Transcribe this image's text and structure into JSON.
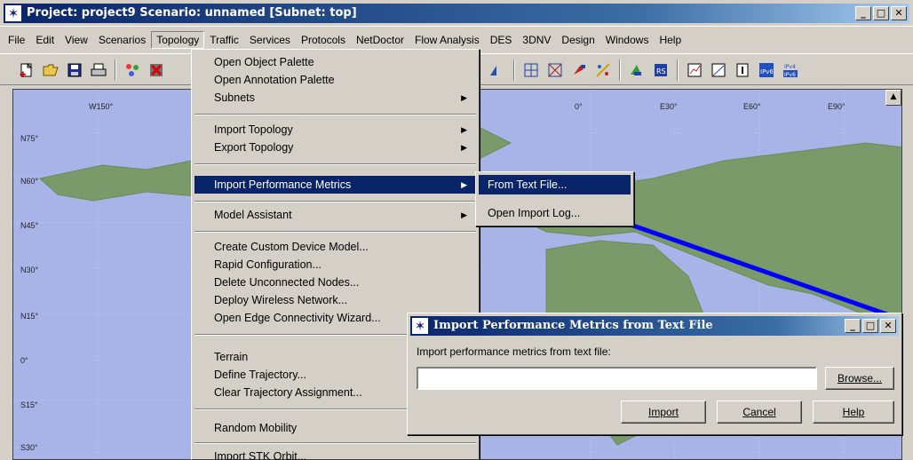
{
  "window": {
    "title": "Project: project9 Scenario: unnamed  [Subnet: top]",
    "minimize": "_",
    "maximize": "□",
    "close": "✕"
  },
  "menubar": [
    "File",
    "Edit",
    "View",
    "Scenarios",
    "Topology",
    "Traffic",
    "Services",
    "Protocols",
    "NetDoctor",
    "Flow Analysis",
    "DES",
    "3DNV",
    "Design",
    "Windows",
    "Help"
  ],
  "map": {
    "longitudes": [
      "W150°",
      "0°",
      "E30°",
      "E60°",
      "E90°"
    ],
    "latitudes": [
      "N75°",
      "N60°",
      "N45°",
      "N30°",
      "N15°",
      "0°",
      "S15°",
      "S30°"
    ],
    "ocean_color": "#a8b4e8",
    "land_color": "#7a9a6a"
  },
  "topology_menu": {
    "items": [
      {
        "label": "Open Object Palette"
      },
      {
        "label": "Open Annotation Palette"
      },
      {
        "label": "Subnets",
        "arrow": "▶"
      },
      {
        "label": "Import Topology",
        "arrow": "▶"
      },
      {
        "label": "Export Topology",
        "arrow": "▶"
      },
      {
        "label": "Import Performance Metrics",
        "arrow": "▶"
      },
      {
        "label": "Model Assistant",
        "arrow": "▶"
      },
      {
        "label": "Create Custom Device Model..."
      },
      {
        "label": "Rapid Configuration..."
      },
      {
        "label": "Delete Unconnected Nodes..."
      },
      {
        "label": "Deploy Wireless Network..."
      },
      {
        "label": "Open Edge Connectivity Wizard..."
      },
      {
        "label": "Terrain",
        "arrow": "▶"
      },
      {
        "label": "Define Trajectory..."
      },
      {
        "label": "Clear Trajectory Assignment..."
      },
      {
        "label": "Random Mobility",
        "arrow": "▶"
      },
      {
        "label": "Import STK Orbit..."
      }
    ]
  },
  "submenu": {
    "items": [
      {
        "label": "From Text File..."
      },
      {
        "label": "Open Import Log..."
      }
    ]
  },
  "dialog": {
    "title": "Import Performance Metrics from Text File",
    "prompt": "Import performance metrics from text file:",
    "path_value": "",
    "browse": "Browse...",
    "import": "Import",
    "cancel": "Cancel",
    "help": "Help"
  },
  "colors": {
    "title_gradient_start": "#0a246a",
    "highlight": "#0a246a",
    "connector": "#0000ff"
  }
}
